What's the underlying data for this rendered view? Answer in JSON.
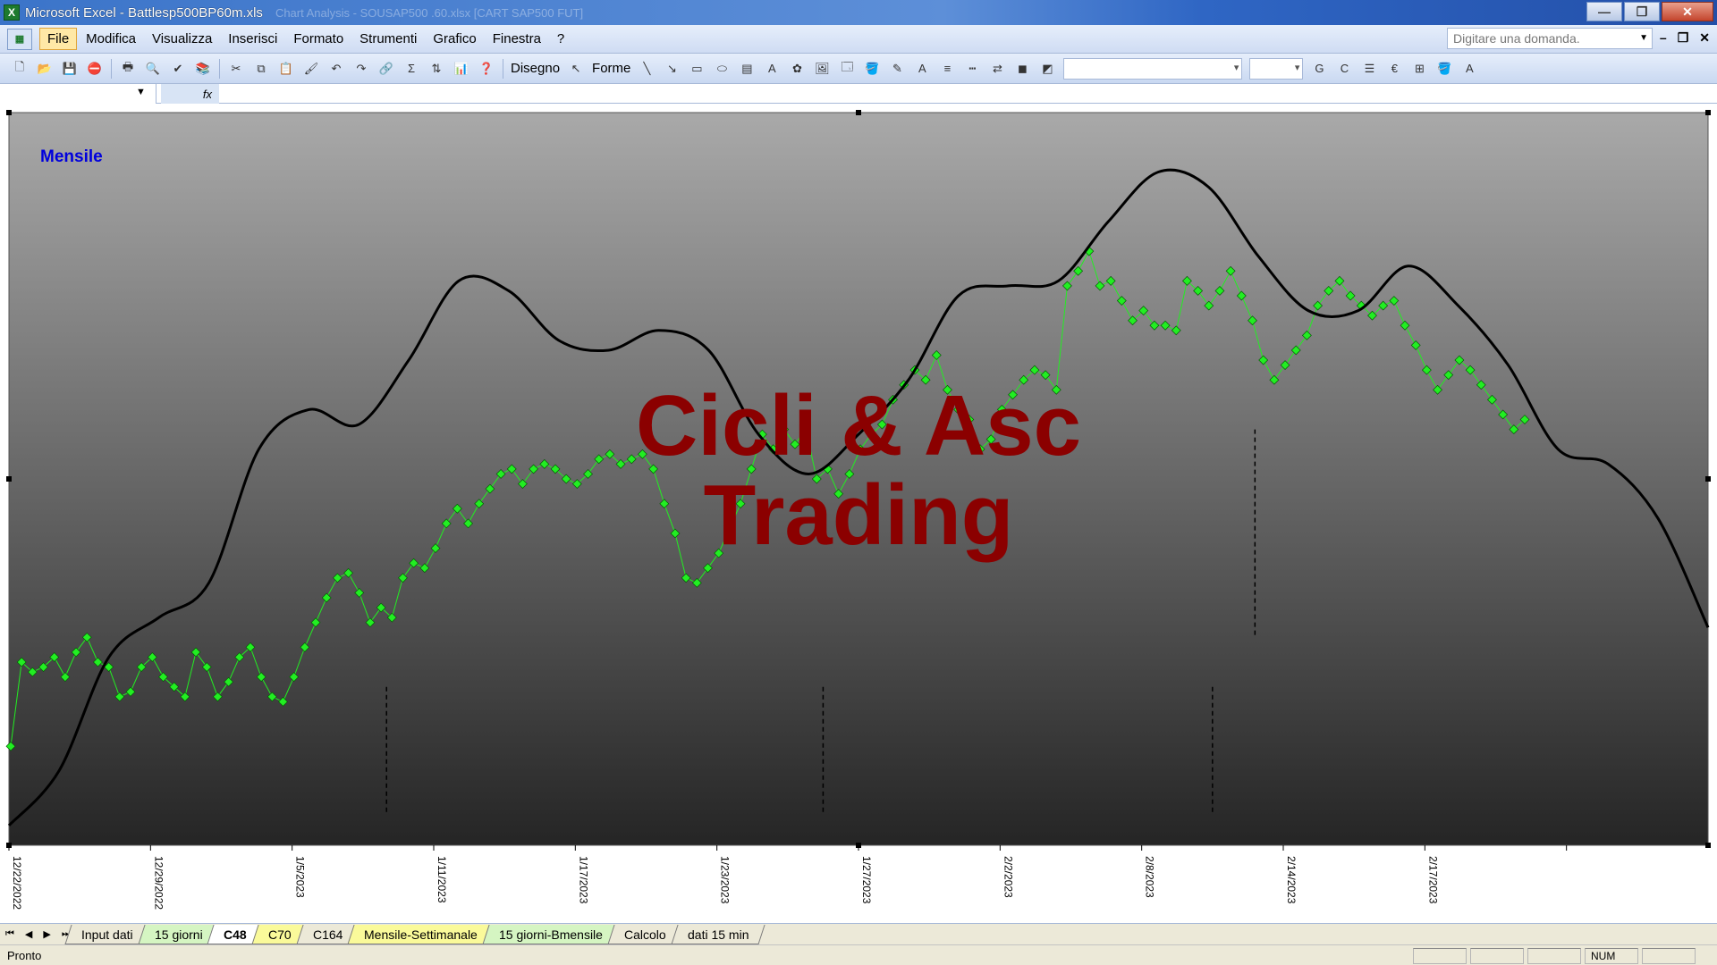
{
  "window": {
    "app_title": "Microsoft Excel - Battlesp500BP60m.xls",
    "faded_title": "Chart Analysis - SOUSAP500 .60.xlsx  [CART SAP500 FUT]",
    "buttons": {
      "minimize": "—",
      "restore": "❐",
      "close": "✕"
    }
  },
  "menu": {
    "items": [
      "File",
      "Modifica",
      "Visualizza",
      "Inserisci",
      "Formato",
      "Strumenti",
      "Grafico",
      "Finestra",
      "?"
    ],
    "help_placeholder": "Digitare una domanda.",
    "doc_controls": [
      "–",
      "❐",
      "✕"
    ]
  },
  "toolbar": {
    "draw_label": "Disegno",
    "shapes_label": "Forme",
    "bold": "G",
    "italic": "C",
    "euro": "€"
  },
  "formula_bar": {
    "fx": "fx"
  },
  "chart": {
    "label": "Mensile",
    "watermark_line1": "Cicli & Asc",
    "watermark_line2": "Trading",
    "background_top": "#a9a9a9",
    "background_bottom": "#252525",
    "marker_color": "#22ee22",
    "cycle_line_color": "#000000",
    "watermark_color": "#8b0000"
  },
  "chart_data": {
    "type": "line",
    "x_ticks": [
      "12/22/2022",
      "12/29/2022",
      "1/5/2023",
      "1/11/2023",
      "1/17/2023",
      "1/23/2023",
      "1/27/2023",
      "2/2/2023",
      "2/8/2023",
      "2/14/2023",
      "2/17/2023",
      ""
    ],
    "series": [
      {
        "values": [
          2.0,
          3.7,
          3.5,
          3.6,
          3.8,
          3.4,
          3.9,
          4.2,
          3.7,
          3.6,
          3.0,
          3.1,
          3.6,
          3.8,
          3.4,
          3.2,
          3.0,
          3.9,
          3.6,
          3.0,
          3.3,
          3.8,
          4.0,
          3.4,
          3.0,
          2.9,
          3.4,
          4.0,
          4.5,
          5.0,
          5.4,
          5.5,
          5.1,
          4.5,
          4.8,
          4.6,
          5.4,
          5.7,
          5.6,
          6.0,
          6.5,
          6.8,
          6.5,
          6.9,
          7.2,
          7.5,
          7.6,
          7.3,
          7.6,
          7.7,
          7.6,
          7.4,
          7.3,
          7.5,
          7.8,
          7.9,
          7.7,
          7.8,
          7.9,
          7.6,
          6.9,
          6.3,
          5.4,
          5.3,
          5.6,
          5.9,
          6.4,
          6.9,
          7.6,
          8.3,
          8.0,
          8.4,
          8.1,
          8.4,
          7.4,
          7.6,
          7.1,
          7.5,
          8.0,
          8.3,
          8.5,
          9.0,
          9.3,
          9.6,
          9.4,
          9.9,
          9.2,
          8.8,
          8.6,
          8.0,
          8.2,
          8.8,
          9.1,
          9.4,
          9.6,
          9.5,
          9.2,
          11.3,
          11.6,
          12.0,
          11.3,
          11.4,
          11.0,
          10.6,
          10.8,
          10.5,
          10.5,
          10.4,
          11.4,
          11.2,
          10.9,
          11.2,
          11.6,
          11.1,
          10.6,
          9.8,
          9.4,
          9.7,
          10.0,
          10.3,
          10.9,
          11.2,
          11.4,
          11.1,
          10.9,
          10.7,
          10.9,
          11.0,
          10.5,
          10.1,
          9.6,
          9.2,
          9.5,
          9.8,
          9.6,
          9.3,
          9.0,
          8.7,
          8.4,
          8.6
        ]
      },
      {
        "values": [
          0.4,
          1.5,
          3.8,
          4.6,
          5.3,
          8.0,
          8.8,
          8.5,
          9.8,
          11.4,
          11.2,
          10.2,
          10.0,
          10.4,
          10.0,
          8.3,
          7.5,
          8.3,
          9.4,
          11.1,
          11.3,
          11.4,
          12.6,
          13.6,
          13.3,
          11.9,
          10.8,
          10.8,
          11.7,
          10.9,
          9.7,
          8.0,
          7.7,
          6.6,
          4.4
        ]
      }
    ],
    "cycle_markers": [
      "1/9/2023",
      "1/26/2023",
      "2/11/2023",
      "2/12/2023"
    ]
  },
  "sheet_tabs": [
    {
      "label": "Input dati",
      "style": "plain"
    },
    {
      "label": "15 giorni",
      "style": "green"
    },
    {
      "label": "C48",
      "style": "active"
    },
    {
      "label": "C70",
      "style": "yellow"
    },
    {
      "label": "C164",
      "style": "plain"
    },
    {
      "label": "Mensile-Settimanale",
      "style": "yellow"
    },
    {
      "label": "15 giorni-Bmensile",
      "style": "green"
    },
    {
      "label": "Calcolo",
      "style": "plain"
    },
    {
      "label": "dati 15 min",
      "style": "plain"
    }
  ],
  "status": {
    "ready": "Pronto",
    "num": "NUM"
  }
}
